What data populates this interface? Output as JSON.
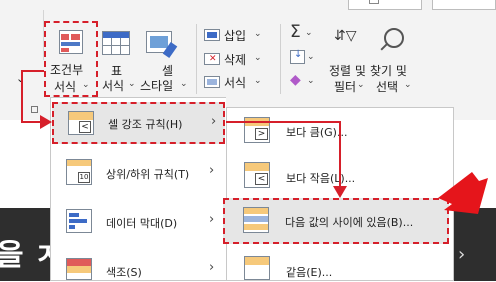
{
  "ribbon": {
    "conditional_formatting": {
      "line1": "조건부",
      "line2": "서식"
    },
    "format_as_table": {
      "line1": "표",
      "line2": "서식"
    },
    "cell_styles": {
      "line1": "셀",
      "line2": "스타일"
    },
    "cells": {
      "insert": "삽입",
      "delete": "삭제",
      "format": "서식"
    },
    "editing": {
      "sort_filter": {
        "line1": "정렬 및",
        "line2": "필터"
      },
      "find_select": {
        "line1": "찾기 및",
        "line2": "선택"
      }
    }
  },
  "menu": {
    "items": [
      {
        "label": "셀 강조 규칙(H)"
      },
      {
        "label": "상위/하위 규칙(T)"
      },
      {
        "label": "데이터 막대(D)"
      },
      {
        "label": "색조(S)"
      }
    ]
  },
  "submenu": {
    "items": [
      {
        "label": "보다 큼(G)..."
      },
      {
        "label": "보다 작음(L)..."
      },
      {
        "label": "다음 값의 사이에 있음(B)..."
      },
      {
        "label": "같음(E)..."
      }
    ]
  },
  "background": {
    "banner_left": "을 ㅈ"
  },
  "colors": {
    "highlight_red": "#d61f2a",
    "selected_bg": "#e6e6e6",
    "menu_bg": "#ffffff"
  }
}
